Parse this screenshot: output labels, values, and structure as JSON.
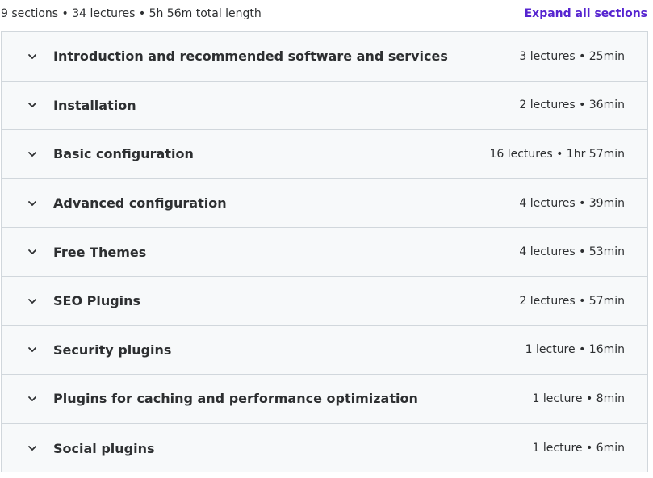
{
  "header": {
    "summary": "9 sections • 34 lectures • 5h 56m total length",
    "expand_all_label": "Expand all sections"
  },
  "colors": {
    "accent": "#5624d0",
    "text": "#2d2f31",
    "border": "#d1d7dc",
    "section_bg": "#f7f9fa"
  },
  "sections": [
    {
      "title": "Introduction and recommended software and services",
      "meta": "3 lectures • 25min",
      "icon": "chevron-down-icon"
    },
    {
      "title": "Installation",
      "meta": "2 lectures • 36min",
      "icon": "chevron-down-icon"
    },
    {
      "title": "Basic configuration",
      "meta": "16 lectures • 1hr 57min",
      "icon": "chevron-down-icon"
    },
    {
      "title": "Advanced configuration",
      "meta": "4 lectures • 39min",
      "icon": "chevron-down-icon"
    },
    {
      "title": "Free Themes",
      "meta": "4 lectures • 53min",
      "icon": "chevron-down-icon"
    },
    {
      "title": "SEO Plugins",
      "meta": "2 lectures • 57min",
      "icon": "chevron-down-icon"
    },
    {
      "title": "Security plugins",
      "meta": "1 lecture • 16min",
      "icon": "chevron-down-icon"
    },
    {
      "title": "Plugins for caching and performance optimization",
      "meta": "1 lecture • 8min",
      "icon": "chevron-down-icon"
    },
    {
      "title": "Social plugins",
      "meta": "1 lecture • 6min",
      "icon": "chevron-down-icon"
    }
  ]
}
